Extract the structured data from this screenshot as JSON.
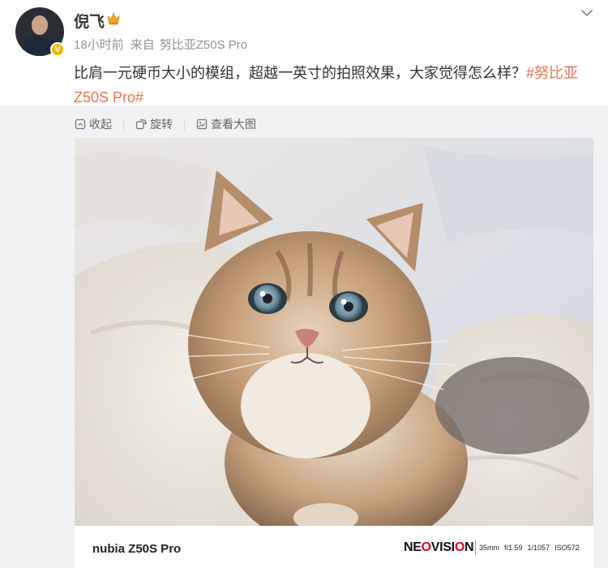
{
  "post": {
    "username": "倪飞",
    "time_ago": "18小时前",
    "source_label": "来自",
    "device": "努比亚Z50S Pro",
    "text": "比肩一元硬币大小的模组，超越一英寸的拍照效果，大家觉得怎么样？",
    "hashtag": "#努比亚Z50S Pro#"
  },
  "actions": {
    "collect": "收起",
    "rotate": "旋转",
    "view_large": "查看大图"
  },
  "photo_footer": {
    "device_name": "nubia Z50S Pro",
    "brand_logo": "NEOVISION",
    "focal_length": "35mm",
    "aperture": "f/1.59",
    "shutter": "1/1057",
    "iso": "ISO572"
  },
  "icons": [
    "crown-icon",
    "chevron-down-icon",
    "collapse-icon",
    "rotate-icon",
    "zoom-image-icon",
    "verified-badge-icon"
  ],
  "colors": {
    "hashtag": "#eb7350",
    "verified": "#f7b500",
    "meta_text": "#939393",
    "repost_bg": "#f2f2f5"
  }
}
